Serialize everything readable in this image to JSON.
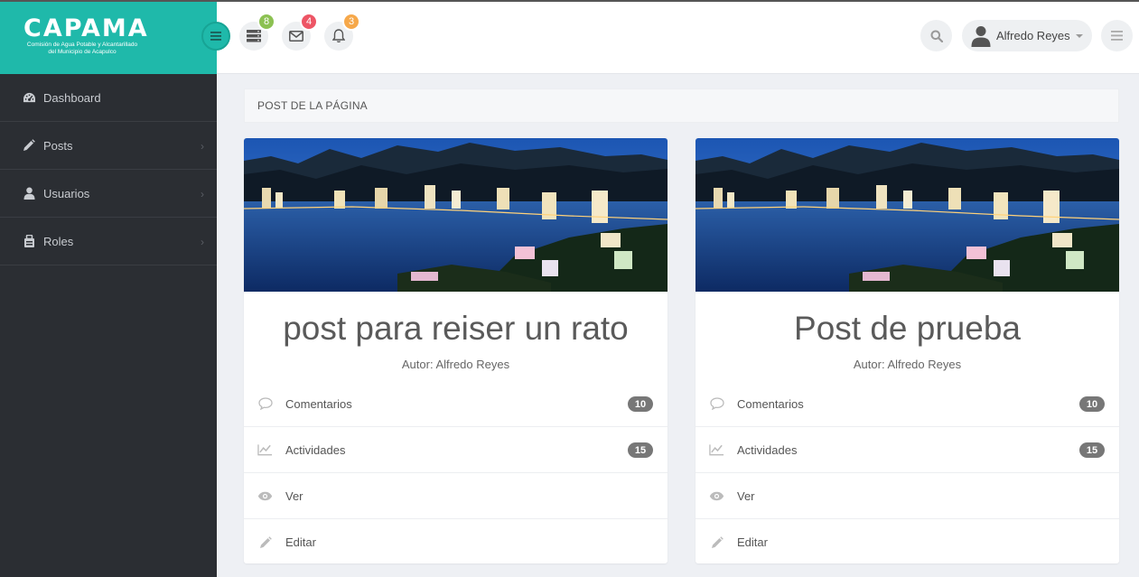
{
  "brand": {
    "title": "CAPAMA",
    "subtitle": "Comisión de Agua Potable y Alcantarillado del Municipio de Acapulco",
    "color": "#1fb9aa"
  },
  "sidebar": {
    "items": [
      {
        "label": "Dashboard",
        "icon": "dashboard-icon",
        "has_chevron": false
      },
      {
        "label": "Posts",
        "icon": "pencil-icon",
        "has_chevron": true
      },
      {
        "label": "Usuarios",
        "icon": "user-icon",
        "has_chevron": true
      },
      {
        "label": "Roles",
        "icon": "roles-icon",
        "has_chevron": true
      }
    ]
  },
  "topbar": {
    "tasks_count": "8",
    "tasks_color": "#8cc152",
    "messages_count": "4",
    "messages_color": "#ed5565",
    "notifications_count": "3",
    "notifications_color": "#f6a84a",
    "user_name": "Alfredo Reyes"
  },
  "main": {
    "page_header": "POST DE LA PÁGINA",
    "cards": [
      {
        "title": "post para reiser un rato",
        "author": "Autor: Alfredo Reyes",
        "comments_label": "Comentarios",
        "comments_count": "10",
        "activities_label": "Actividades",
        "activities_count": "15",
        "view_label": "Ver",
        "edit_label": "Editar"
      },
      {
        "title": "Post de prueba",
        "author": "Autor: Alfredo Reyes",
        "comments_label": "Comentarios",
        "comments_count": "10",
        "activities_label": "Actividades",
        "activities_count": "15",
        "view_label": "Ver",
        "edit_label": "Editar"
      }
    ]
  }
}
